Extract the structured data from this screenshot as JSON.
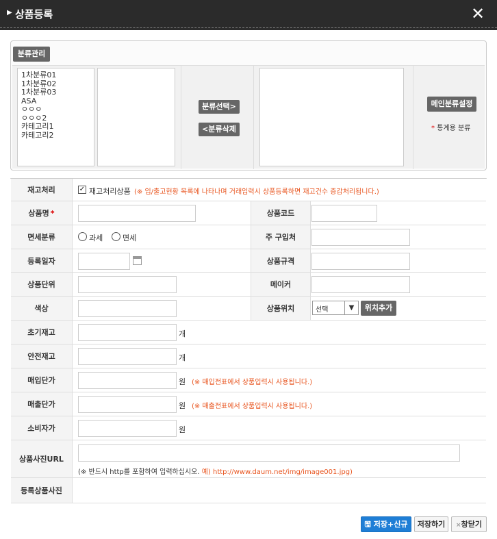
{
  "window": {
    "title": "상품등록"
  },
  "category": {
    "manage_label": "분류관리",
    "list": [
      "1차분류01",
      "1차분류02",
      "1차분류03",
      "ASA",
      "ㅇㅇㅇ",
      "ㅇㅇㅇ2",
      "카테고리1",
      "카테고리2"
    ],
    "select_label": "분류선택>",
    "delete_label": "<분류삭제",
    "main_set_label": "메인분류설정",
    "stat_note_star": "*",
    "stat_note": "통계용 분류"
  },
  "form": {
    "stock_label": "재고처리",
    "stock_checkbox_label": "재고처리상품",
    "stock_checked": true,
    "stock_hint": "(※ 입/출고현황 목록에 나타나며 거래입력시 상품등록하면 재고건수 증감처리됩니다.)",
    "name_label": "상품명",
    "name_req": "*",
    "code_label": "상품코드",
    "tax_label": "면세분류",
    "tax_options": [
      "과세",
      "면세"
    ],
    "purchase_label": "주 구입처",
    "reg_date_label": "등록일자",
    "spec_label": "상품규격",
    "unit_label": "상품단위",
    "maker_label": "메이커",
    "color_label": "색상",
    "location_label": "상품위치",
    "location_select": "선택",
    "location_add": "위치추가",
    "init_stock_label": "초기재고",
    "safe_stock_label": "안전재고",
    "count_unit": "개",
    "buy_price_label": "매입단가",
    "buy_hint": "(※ 매입전표에서 상품입력시 사용됩니다.)",
    "sell_price_label": "매출단가",
    "sell_hint": "(※ 매출전표에서 상품입력시 사용됩니다.)",
    "consumer_price_label": "소비자가",
    "won_unit": "원",
    "photo_url_label": "상품사진URL",
    "photo_hint_prefix": "(※ 반드시 http를 포함하여 입력하십시오.",
    "photo_hint_example": "예) http://www.daum.net/img/image001.jpg)",
    "photo_label": "등록상품사진"
  },
  "footer": {
    "save_new": "저장+신규",
    "save": "저장하기",
    "close": "창닫기",
    "close_icon": "×"
  }
}
